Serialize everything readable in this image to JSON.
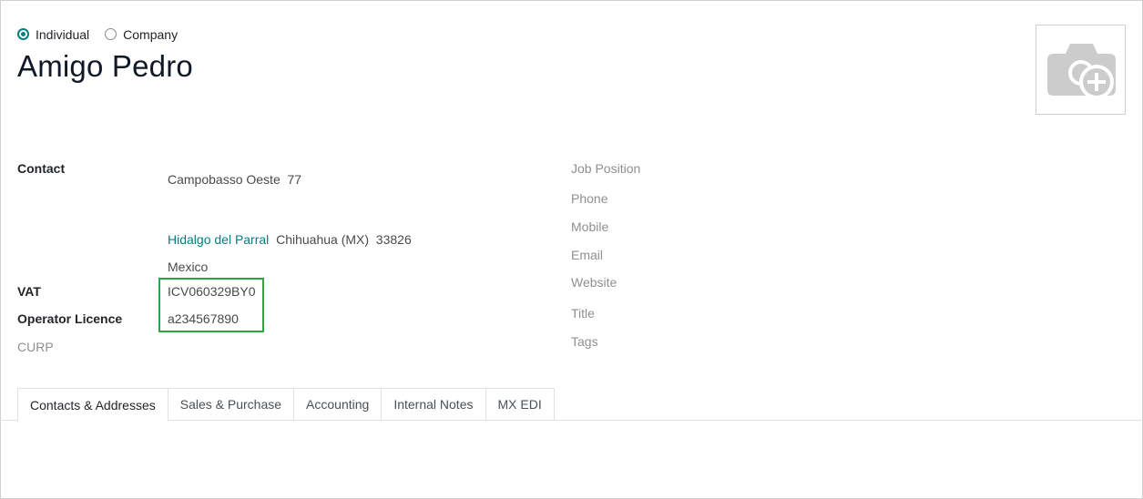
{
  "partner_type": {
    "options": [
      {
        "label": "Individual",
        "checked": true
      },
      {
        "label": "Company",
        "checked": false
      }
    ]
  },
  "name": "Amigo Pedro",
  "avatar": {
    "icon": "camera-plus-icon"
  },
  "fields_left": {
    "contact_label": "Contact",
    "street": "Campobasso Oeste",
    "street_number": "77",
    "city": "Hidalgo del Parral",
    "state": "Chihuahua (MX)",
    "zip": "33826",
    "country": "Mexico",
    "vat_label": "VAT",
    "vat_value": "ICV060329BY0",
    "operator_label": "Operator Licence",
    "operator_value": "a234567890",
    "curp_label": "CURP"
  },
  "fields_right": {
    "job_position": "Job Position",
    "phone": "Phone",
    "mobile": "Mobile",
    "email": "Email",
    "website": "Website",
    "title": "Title",
    "tags": "Tags"
  },
  "tabs": [
    {
      "label": "Contacts & Addresses",
      "active": true
    },
    {
      "label": "Sales & Purchase",
      "active": false
    },
    {
      "label": "Accounting",
      "active": false
    },
    {
      "label": "Internal Notes",
      "active": false
    },
    {
      "label": "MX EDI",
      "active": false
    }
  ],
  "colors": {
    "accent": "#017e84",
    "highlight": "#28a745"
  }
}
